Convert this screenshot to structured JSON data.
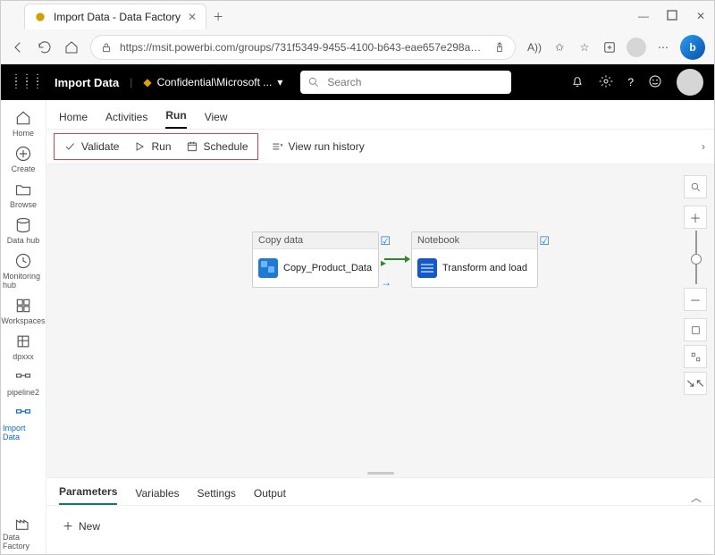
{
  "browser": {
    "tab_title": "Import Data - Data Factory",
    "url": "https://msit.powerbi.com/groups/731f5349-9455-4100-b643-eae657e298a4/pip..."
  },
  "header": {
    "workspace_title": "Import Data",
    "sensitivity": "Confidential\\Microsoft ...",
    "sens_toggle": "▾",
    "search_placeholder": "Search"
  },
  "leftnav": {
    "items": [
      {
        "label": "Home"
      },
      {
        "label": "Create"
      },
      {
        "label": "Browse"
      },
      {
        "label": "Data hub"
      },
      {
        "label": "Monitoring hub"
      },
      {
        "label": "Workspaces"
      },
      {
        "label": "dpxxx"
      },
      {
        "label": "pipeline2"
      },
      {
        "label": "Import Data"
      }
    ],
    "footer": "Data Factory"
  },
  "tabs": {
    "items": [
      "Home",
      "Activities",
      "Run",
      "View"
    ],
    "active": 2
  },
  "toolbar": {
    "validate": "Validate",
    "run": "Run",
    "schedule": "Schedule",
    "history": "View run history"
  },
  "nodes": {
    "copy": {
      "type": "Copy data",
      "name": "Copy_Product_Data"
    },
    "note": {
      "type": "Notebook",
      "name": "Transform and load"
    }
  },
  "panel": {
    "tabs": [
      "Parameters",
      "Variables",
      "Settings",
      "Output"
    ],
    "active": 0,
    "new": "New"
  }
}
